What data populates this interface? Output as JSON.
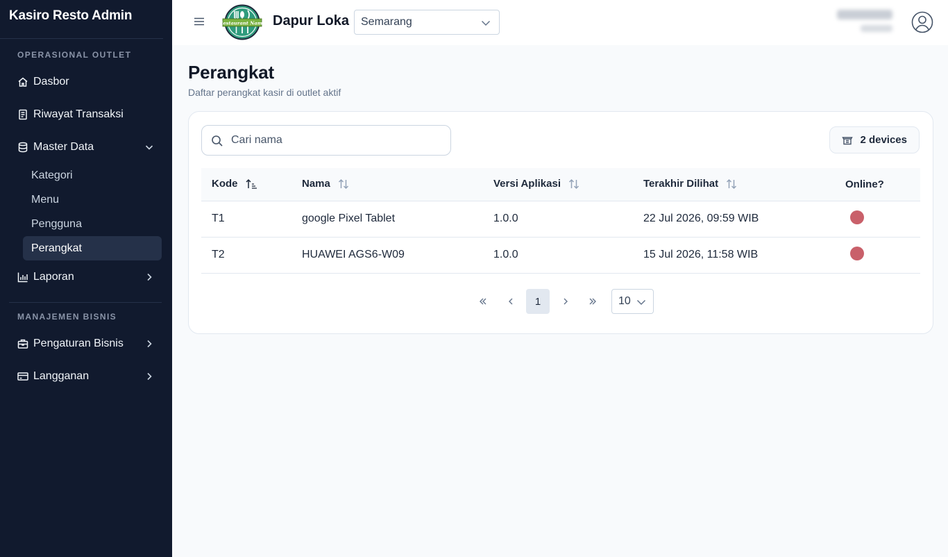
{
  "app": {
    "title": "Kasiro Resto Admin"
  },
  "sidebar": {
    "sections": [
      {
        "label": "OPERASIONAL OUTLET",
        "items": [
          {
            "label": "Dasbor",
            "icon": "home-icon"
          },
          {
            "label": "Riwayat Transaksi",
            "icon": "receipt-icon"
          },
          {
            "label": "Master Data",
            "icon": "database-icon",
            "expanded": true,
            "children": [
              {
                "label": "Kategori"
              },
              {
                "label": "Menu"
              },
              {
                "label": "Pengguna"
              },
              {
                "label": "Perangkat",
                "active": true
              }
            ]
          },
          {
            "label": "Laporan",
            "icon": "bar-chart-icon"
          }
        ]
      },
      {
        "label": "MANAJEMEN BISNIS",
        "items": [
          {
            "label": "Pengaturan Bisnis",
            "icon": "briefcase-icon"
          },
          {
            "label": "Langganan",
            "icon": "credit-card-icon"
          }
        ]
      }
    ]
  },
  "header": {
    "outlet_name": "Dapur Loka",
    "logo_text": "Restaurant Name",
    "outlet_select": {
      "value": "Semarang"
    }
  },
  "page": {
    "title": "Perangkat",
    "subtitle": "Daftar perangkat kasir di outlet aktif"
  },
  "toolbar": {
    "search_placeholder": "Cari nama",
    "devices_count": "2 devices"
  },
  "table": {
    "columns": [
      "Kode",
      "Nama",
      "Versi Aplikasi",
      "Terakhir Dilihat",
      "Online?"
    ],
    "rows": [
      {
        "kode": "T1",
        "nama": "google Pixel Tablet",
        "versi": "1.0.0",
        "terakhir": "22 Jul 2026, 09:59 WIB",
        "online": false
      },
      {
        "kode": "T2",
        "nama": "HUAWEI AGS6-W09",
        "versi": "1.0.0",
        "terakhir": "15 Jul 2026, 11:58 WIB",
        "online": false
      }
    ]
  },
  "pagination": {
    "current_page": "1",
    "page_size": "10"
  },
  "colors": {
    "sidebar_bg": "#111a2e",
    "offline_dot": "#c9606a",
    "logo_green": "#2f9b7d"
  }
}
